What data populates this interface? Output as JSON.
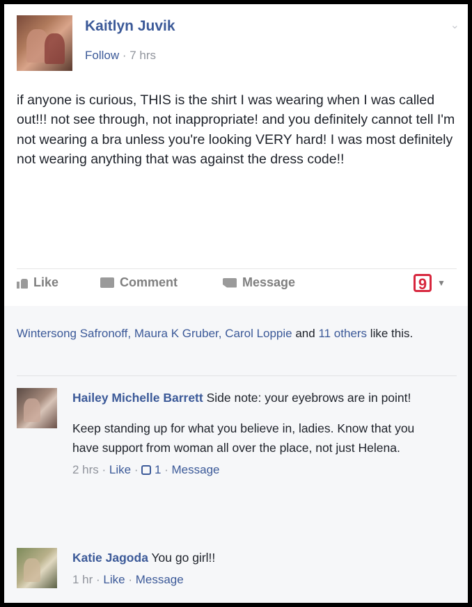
{
  "post": {
    "author": "Kaitlyn Juvik",
    "follow": "Follow",
    "dot": " · ",
    "time": "7 hrs",
    "text": "if anyone is curious, THIS is the shirt I was wearing when I was called out!!! not see through, not inappropriate! and you definitely cannot tell I'm not wearing a bra unless you're looking VERY hard! I was most definitely not wearing anything that was against the dress code!!"
  },
  "actions": {
    "like": "Like",
    "comment": "Comment",
    "message": "Message",
    "brand": "9"
  },
  "likes_summary": {
    "names": "Wintersong Safronoff, Maura K Gruber, Carol Loppie",
    "and": " and ",
    "others": "11 others",
    "suffix": " like this."
  },
  "comments": [
    {
      "name": "Hailey Michelle Barrett",
      "text": "Side note: your eyebrows are in point!",
      "text2": "Keep standing up for what you believe in, ladies. Know that you have support from woman all over the place, not just Helena.",
      "time": "2 hrs",
      "like": "Like",
      "likes_count": "1",
      "message": "Message"
    },
    {
      "name": "Katie Jagoda",
      "text": "You go girl!!",
      "time": "1 hr",
      "like": "Like",
      "message": "Message"
    }
  ],
  "colors": {
    "link": "#3b5998",
    "meta": "#90949c",
    "brand": "#d7263d"
  }
}
